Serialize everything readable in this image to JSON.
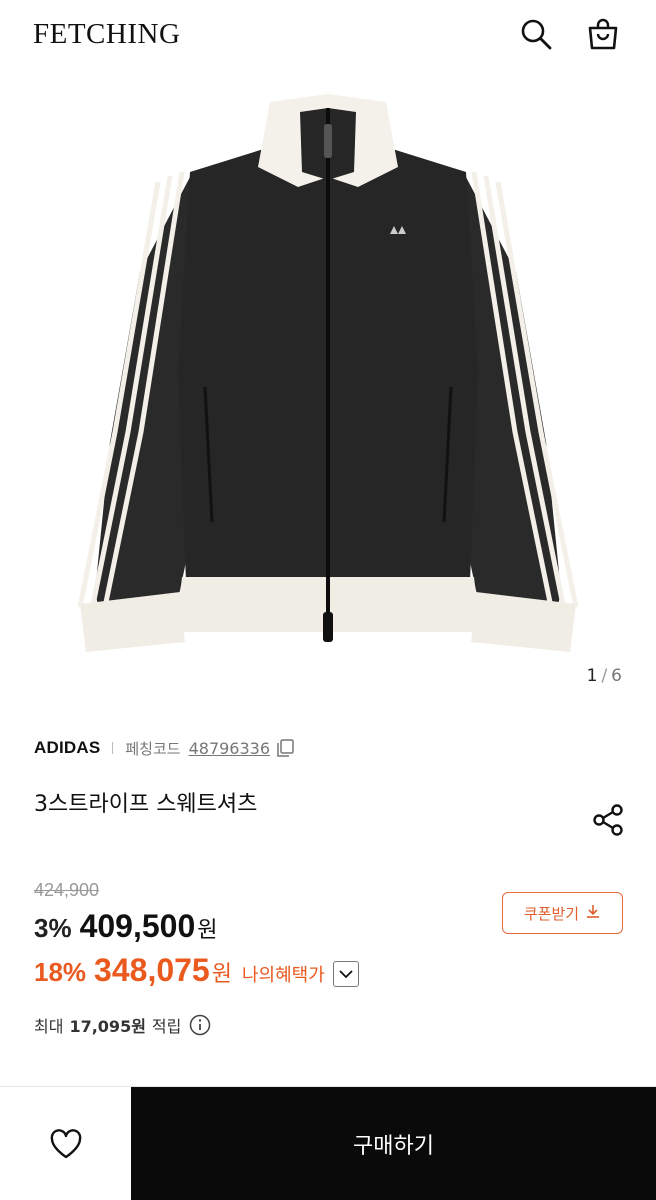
{
  "header": {
    "logo": "FETCHING"
  },
  "gallery": {
    "current": "1",
    "separator": "/",
    "total": "6"
  },
  "product": {
    "brand": "ADIDAS",
    "code_label": "페칭코드",
    "code_value": "48796336",
    "title": "3스트라이프 스웨트셔츠"
  },
  "pricing": {
    "original_price": "424,900",
    "discount_percent": "3%",
    "price": "409,500",
    "currency": "원",
    "benefit_percent": "18%",
    "benefit_price": "348,075",
    "benefit_label": "나의혜택가",
    "coupon_label": "쿠폰받기",
    "points_prefix": "최대",
    "points_amount": "17,095원",
    "points_suffix": "적립"
  },
  "bottom": {
    "buy_label": "구매하기"
  },
  "colors": {
    "accent": "#ea5a1f",
    "buy_bg": "#0a0a0a"
  }
}
